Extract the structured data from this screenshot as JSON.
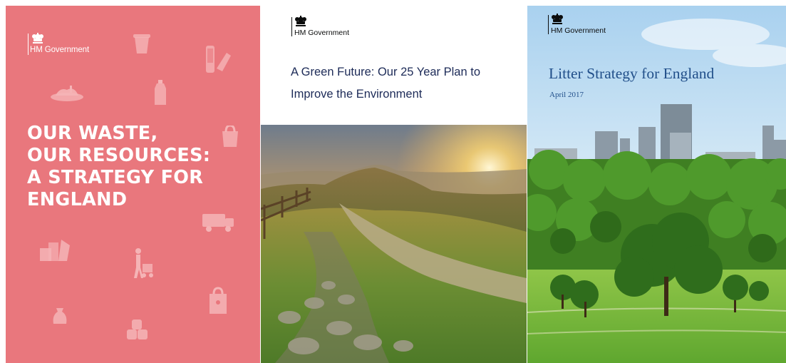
{
  "covers": {
    "waste": {
      "publisher": "HM Government",
      "title_lines": [
        "OUR WASTE,",
        "OUR RESOURCES:",
        "A STRATEGY FOR",
        "ENGLAND"
      ],
      "background_color": "#e9777d",
      "decorative_icons": [
        "coffee-cup-icon",
        "drinks-can-icon",
        "glass-bottle-icon",
        "landfill-site-icon",
        "plastic-bottle-icon",
        "plastic-bag-icon",
        "refuse-lorry-icon",
        "waste-pile-icon",
        "person-with-trolley-icon",
        "sack-icon",
        "paper-bag-icon",
        "stacked-cans-icon"
      ]
    },
    "green": {
      "publisher": "HM Government",
      "title": "A Green Future: Our 25 Year Plan to Improve the Environment",
      "title_color": "#1d2b58"
    },
    "litter": {
      "publisher": "HM Government",
      "title": "Litter Strategy for England",
      "date": "April 2017",
      "text_color": "#214f8a"
    }
  }
}
